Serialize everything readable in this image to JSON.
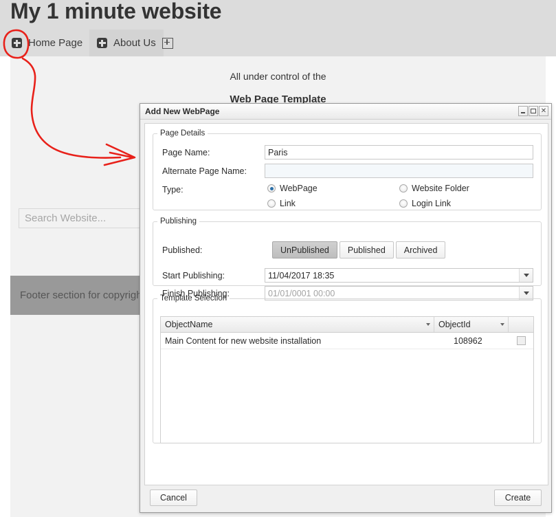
{
  "site": {
    "title": "My 1 minute website",
    "nav": [
      {
        "label": "Home Page",
        "icon": "plus-square-icon"
      },
      {
        "label": "About Us",
        "icon": "plus-square-icon"
      }
    ],
    "add_tab_icon": "plus-outline-icon",
    "content_line_1": "All under control of the",
    "content_line_2": "Web Page Template",
    "search_placeholder": "Search Website...",
    "search_value": "",
    "footer_text": "Footer section for copyright notice",
    "colors": {
      "header_band": "#dcdcdc",
      "content": "#f2f2f2",
      "footer": "#999999",
      "annotation": "#e8211a"
    }
  },
  "dialog": {
    "title": "Add New WebPage",
    "window_controls": [
      {
        "name": "minimize",
        "glyph": ""
      },
      {
        "name": "maximize",
        "glyph": ""
      },
      {
        "name": "close",
        "glyph": "✕"
      }
    ],
    "page_details": {
      "legend": "Page Details",
      "page_name_label": "Page Name:",
      "page_name_value": "Paris",
      "alternate_page_name_label": "Alternate Page Name:",
      "alternate_page_name_value": "",
      "type_label": "Type:",
      "type_options": [
        {
          "label": "WebPage",
          "selected": true
        },
        {
          "label": "Website Folder",
          "selected": false
        },
        {
          "label": "Link",
          "selected": false
        },
        {
          "label": "Login Link",
          "selected": false
        }
      ]
    },
    "publishing": {
      "legend": "Publishing",
      "published_label": "Published:",
      "published_options": [
        {
          "label": "UnPublished",
          "active": true
        },
        {
          "label": "Published",
          "active": false
        },
        {
          "label": "Archived",
          "active": false
        }
      ],
      "start_publishing_label": "Start Publishing:",
      "start_publishing_value": "11/04/2017 18:35",
      "finish_publishing_label": "Finish Publishing:",
      "finish_publishing_value": "01/01/0001 00:00"
    },
    "template_selection": {
      "legend": "Template Selection",
      "columns": [
        "ObjectName",
        "ObjectId",
        ""
      ],
      "rows": [
        {
          "object_name": "Main Content for new website installation",
          "object_id": "108962",
          "selected": false
        }
      ]
    },
    "cancel_label": "Cancel",
    "create_label": "Create"
  }
}
